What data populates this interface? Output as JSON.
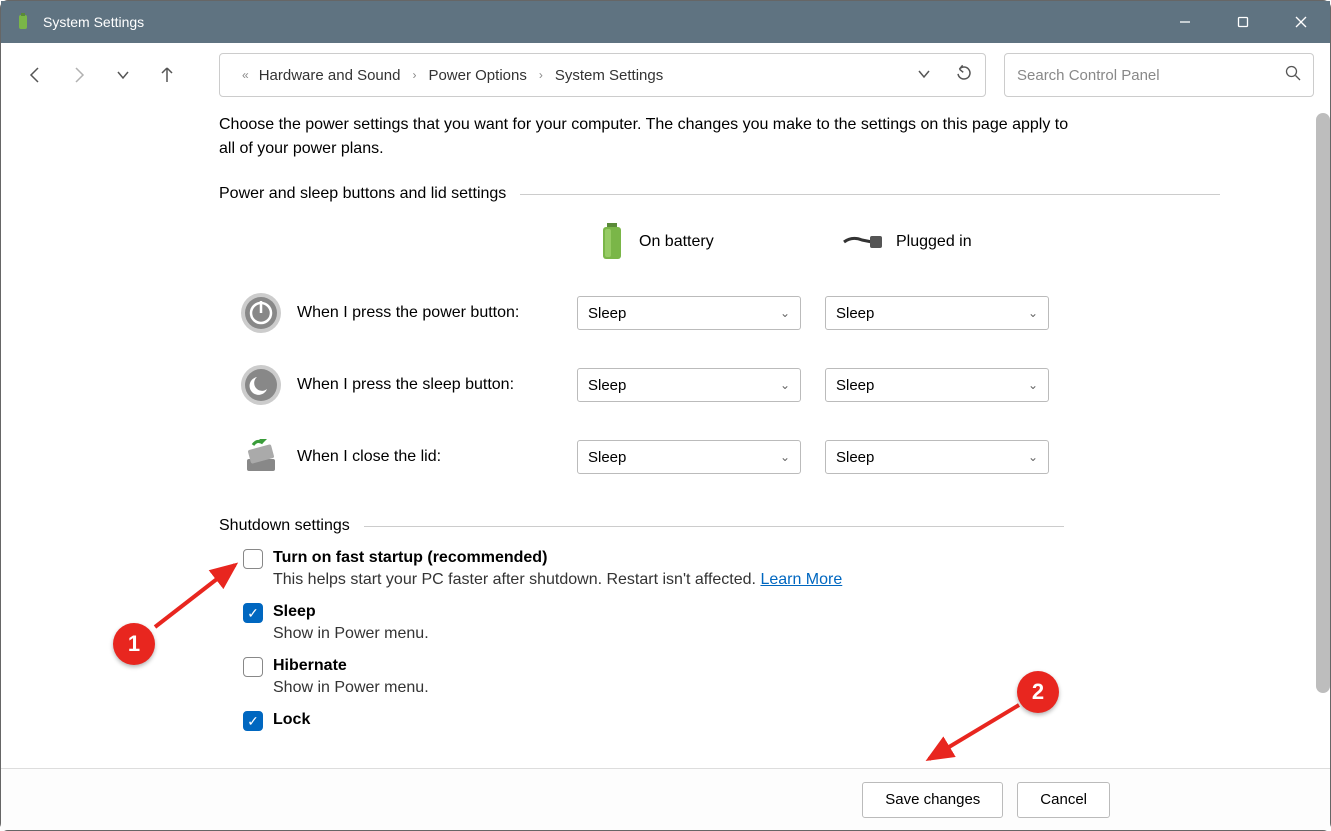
{
  "window": {
    "title": "System Settings"
  },
  "breadcrumb": {
    "level1": "Hardware and Sound",
    "level2": "Power Options",
    "level3": "System Settings"
  },
  "search": {
    "placeholder": "Search Control Panel"
  },
  "main": {
    "description": "Choose the power settings that you want for your computer. The changes you make to the settings on this page apply to all of your power plans.",
    "section1_label": "Power and sleep buttons and lid settings",
    "columns": {
      "battery": "On battery",
      "plugged": "Plugged in"
    },
    "rows": [
      {
        "label": "When I press the power button:",
        "battery": "Sleep",
        "plugged": "Sleep"
      },
      {
        "label": "When I press the sleep button:",
        "battery": "Sleep",
        "plugged": "Sleep"
      },
      {
        "label": "When I close the lid:",
        "battery": "Sleep",
        "plugged": "Sleep"
      }
    ],
    "section2_label": "Shutdown settings",
    "shutdown": [
      {
        "label": "Turn on fast startup (recommended)",
        "desc": "This helps start your PC faster after shutdown. Restart isn't affected.",
        "link": "Learn More",
        "checked": false
      },
      {
        "label": "Sleep",
        "desc": "Show in Power menu.",
        "checked": true
      },
      {
        "label": "Hibernate",
        "desc": "Show in Power menu.",
        "checked": false
      },
      {
        "label": "Lock",
        "desc": "",
        "checked": true
      }
    ]
  },
  "buttons": {
    "save": "Save changes",
    "cancel": "Cancel"
  },
  "annotations": {
    "n1": "1",
    "n2": "2"
  }
}
